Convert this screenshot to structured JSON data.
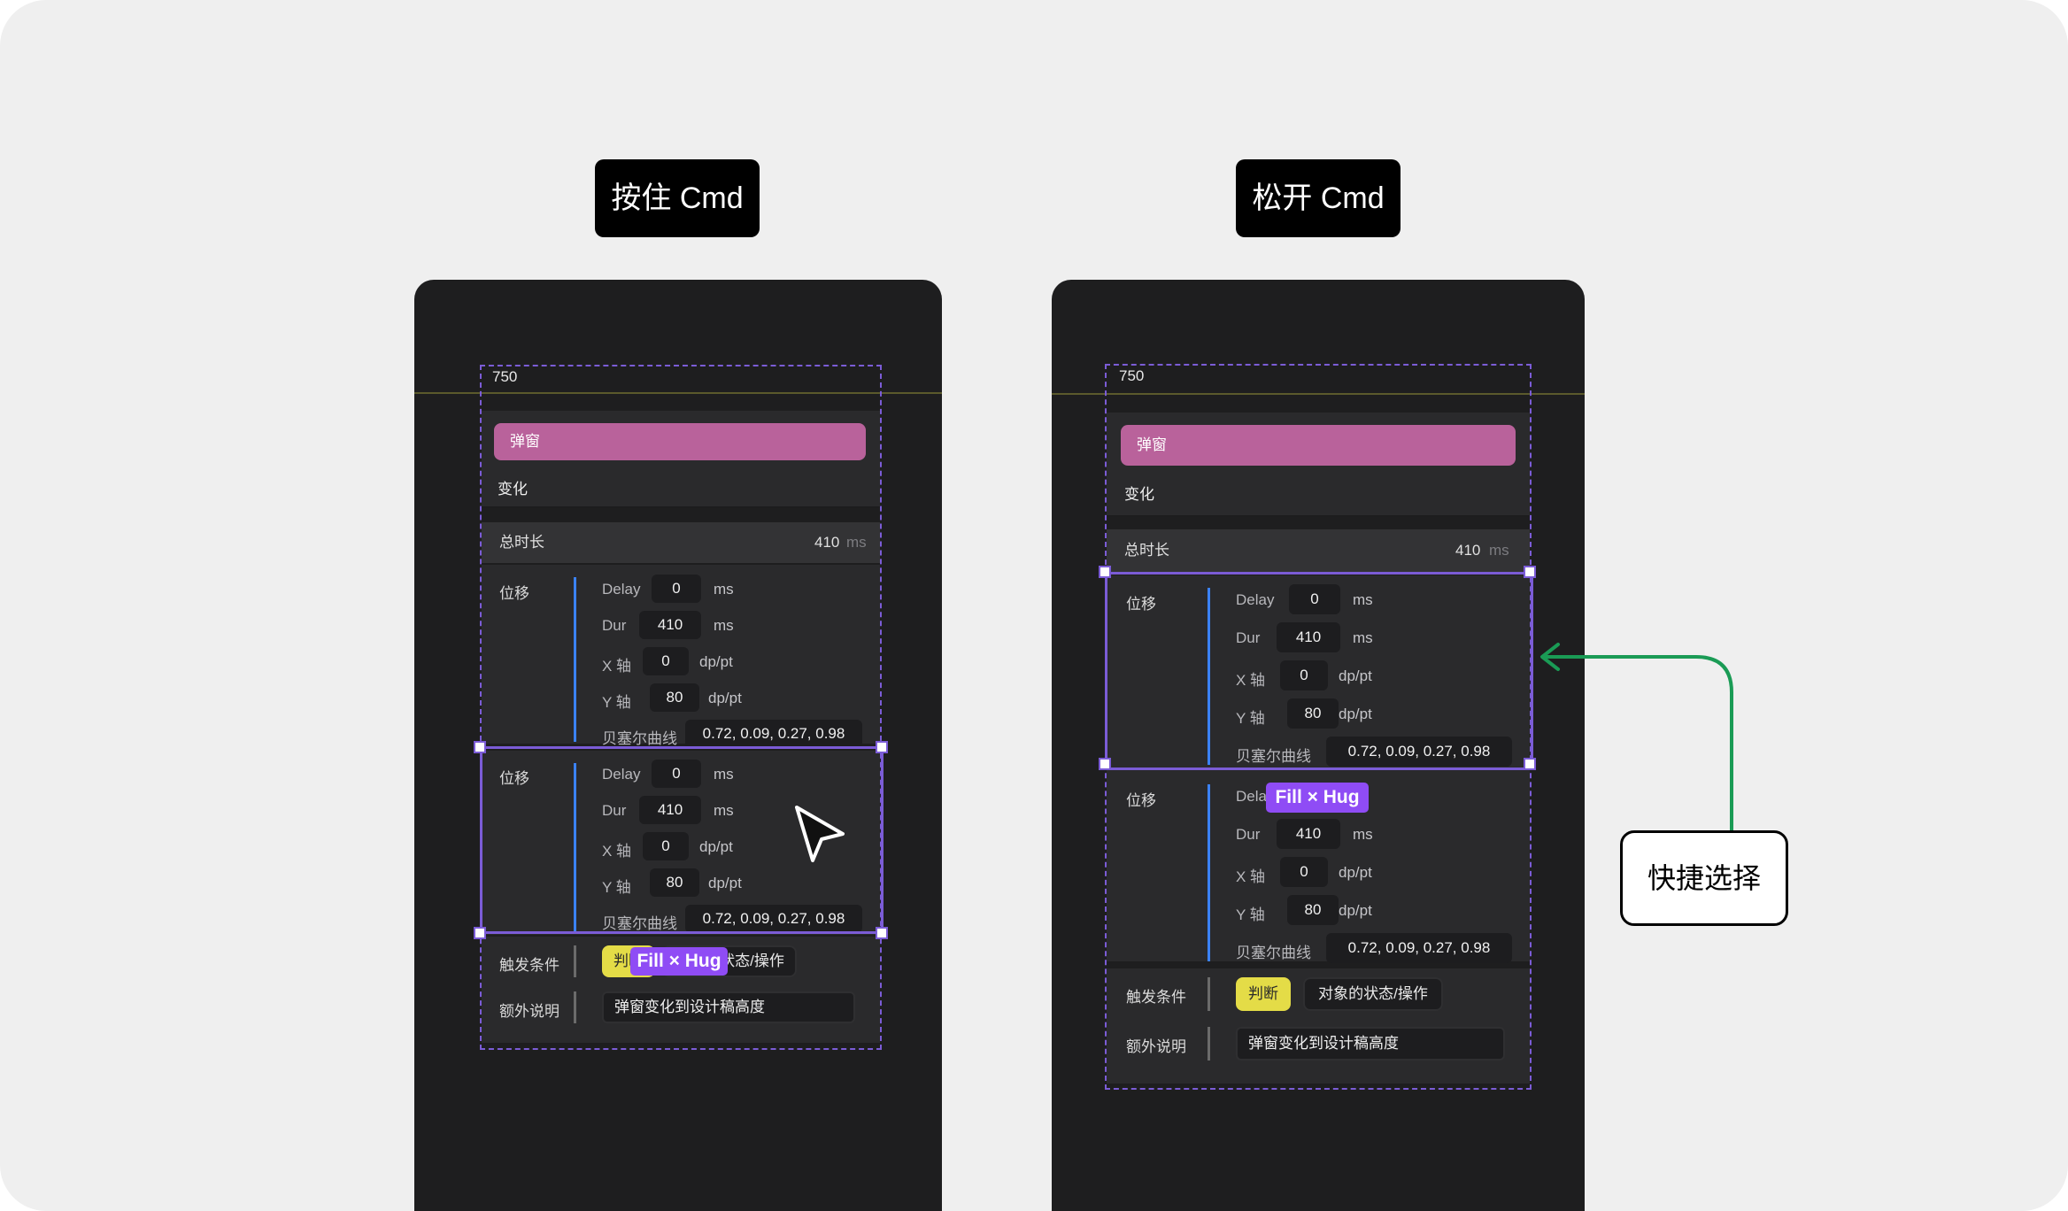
{
  "captions": {
    "hold": "按住 Cmd",
    "release": "松开 Cmd"
  },
  "callout": {
    "label": "快捷选择"
  },
  "hug_label": "Fill × Hug",
  "panel": {
    "frame_width": "750",
    "pill_label": "弹窗",
    "change_label": "变化",
    "total": {
      "label": "总时长",
      "value": "410",
      "unit": "ms"
    },
    "group_title": "位移",
    "rows": {
      "delay": {
        "label": "Delay",
        "value": "0",
        "unit": "ms"
      },
      "dur": {
        "label": "Dur",
        "value": "410",
        "unit": "ms"
      },
      "x": {
        "label": "X 轴",
        "value": "0",
        "unit": "dp/pt"
      },
      "y": {
        "label": "Y 轴",
        "value": "80",
        "unit": "dp/pt"
      },
      "bezier": {
        "label": "贝塞尔曲线",
        "value": "0.72, 0.09, 0.27, 0.98"
      }
    },
    "trigger": {
      "label": "触发条件",
      "tag": "判断",
      "target": "对象的状态/操作"
    },
    "note": {
      "label": "额外说明",
      "value": "弹窗变化到设计稿高度"
    }
  },
  "colors": {
    "pill": "#b9629b",
    "selection": "#7b5cd6",
    "hug": "#8f4cf5",
    "arrow": "#1a9b55",
    "tag": "#e4dc47"
  }
}
